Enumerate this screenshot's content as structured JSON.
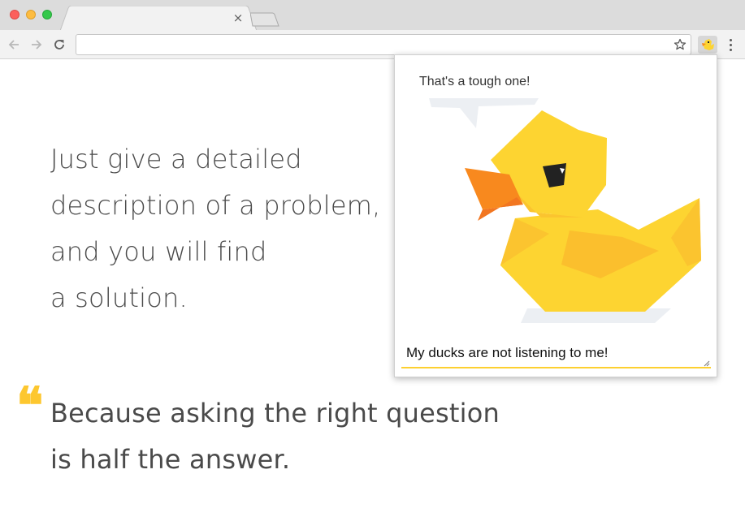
{
  "browser": {
    "tab_close_glyph": "×",
    "address_value": "",
    "icons": {
      "back": "arrow-left",
      "forward": "arrow-right",
      "reload": "reload",
      "bookmark": "star",
      "extension": "rubber-duck",
      "menu": "vertical-ellipsis"
    }
  },
  "content": {
    "lead_lines": [
      "Just give a detailed",
      "description of a problem,",
      "and you will find",
      "a solution."
    ],
    "quote_mark": "❝",
    "quote_lines": [
      "Because asking the right question",
      "is half the answer."
    ]
  },
  "popup": {
    "speech_text": "That's a tough one!",
    "input_value": "My ducks are not listening to me!"
  },
  "colors": {
    "accent": "#fdd030",
    "duck_body": "#fdd431",
    "duck_shade": "#fbbf2d",
    "beak": "#f8891e",
    "text": "#4a4a4a"
  }
}
